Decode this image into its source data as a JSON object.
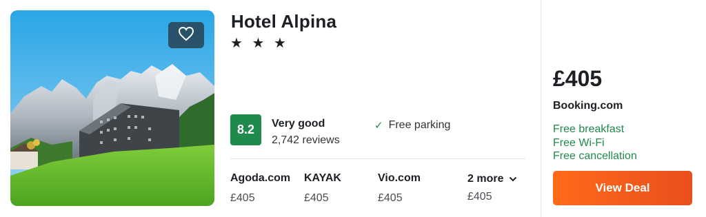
{
  "hotel": {
    "name": "Hotel Alpina",
    "stars_text": "★ ★ ★",
    "star_rating": 3
  },
  "rating": {
    "score": "8.2",
    "label": "Very good",
    "reviews": "2,742 reviews"
  },
  "amenity": {
    "icon": "check-icon",
    "label": "Free parking"
  },
  "providers": [
    {
      "name": "Agoda.com",
      "price": "£405"
    },
    {
      "name": "KAYAK",
      "price": "£405"
    },
    {
      "name": "Vio.com",
      "price": "£405"
    }
  ],
  "more": {
    "label": "2 more",
    "price": "£405",
    "icon": "chevron-down-icon"
  },
  "deal": {
    "price": "£405",
    "site": "Booking.com",
    "perks": [
      "Free breakfast",
      "Free Wi-Fi",
      "Free cancellation"
    ],
    "button_label": "View Deal"
  },
  "colors": {
    "score_badge": "#1f8a4c",
    "perk_text": "#1f8a4c",
    "cta": "#ff6a1a"
  },
  "icons": {
    "favorite": "heart-icon"
  }
}
